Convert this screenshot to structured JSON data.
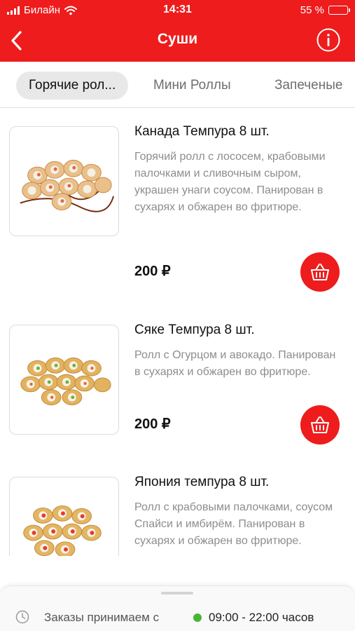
{
  "status_bar": {
    "carrier": "Билайн",
    "time": "14:31",
    "battery": "55 %",
    "battery_level": 0.55
  },
  "header": {
    "title": "Суши",
    "back_icon": "chevron-left-icon",
    "info_icon": "info-icon",
    "color": "#ee1c1c"
  },
  "tabs": [
    {
      "label": "Горячие рол...",
      "active": true
    },
    {
      "label": "Мини Роллы",
      "active": false
    },
    {
      "label": "Запеченые",
      "active": false
    }
  ],
  "products": [
    {
      "name": "Канада Темпура 8 шт.",
      "description": "Горячий ролл с лососем, крабовыми палочками и сливочным сыром, украшен унаги соусом. Панирован в сухарях и обжарен во фритюре.",
      "price": "200 ₽",
      "image_icon": "sushi-roll-image"
    },
    {
      "name": "Сяке Темпура 8 шт.",
      "description": "Ролл с Огурцом и авокадо. Панирован в сухарях и обжарен во фритюре.",
      "price": "200 ₽",
      "image_icon": "sushi-roll-image"
    },
    {
      "name": "Япония темпура 8 шт.",
      "description": "Ролл с крабовыми палочками, соусом Спайси и имбирём. Панирован в сухарях и обжарен во фритюре.",
      "price": "",
      "image_icon": "sushi-roll-image"
    }
  ],
  "cart_icon": "basket-icon",
  "footer": {
    "hours_label": "Заказы принимаем с",
    "hours_value": "09:00 - 22:00 часов",
    "status_color": "#4ab534"
  }
}
